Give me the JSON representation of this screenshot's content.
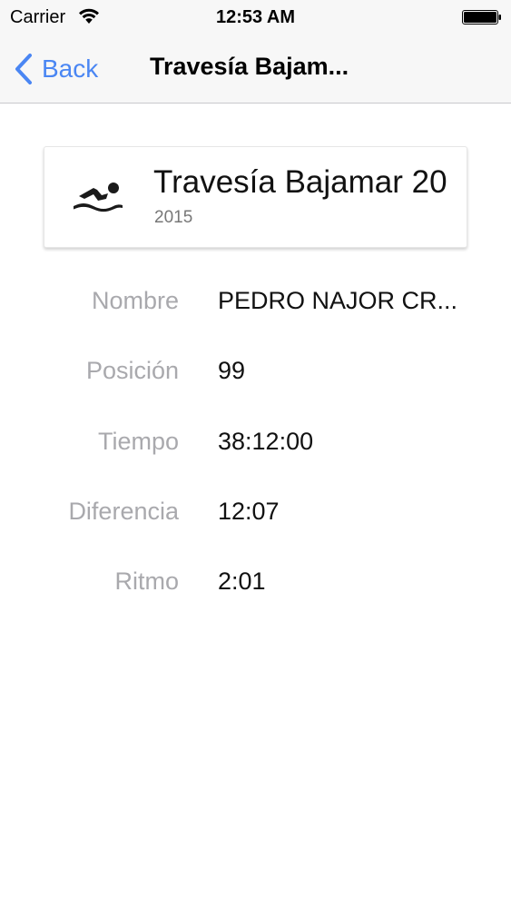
{
  "status_bar": {
    "carrier": "Carrier",
    "time": "12:53 AM",
    "wifi_icon": "wifi-icon",
    "battery_icon": "battery-icon"
  },
  "nav": {
    "back_label": "Back",
    "title": "Travesía Bajam...",
    "back_icon": "chevron-left-icon",
    "accent_color": "#4a86f3"
  },
  "event": {
    "icon": "swimmer-icon",
    "name": "Travesía Bajamar 20",
    "year": "2015"
  },
  "details": [
    {
      "label": "Nombre",
      "value": "PEDRO NAJOR CR..."
    },
    {
      "label": "Posición",
      "value": "99"
    },
    {
      "label": "Tiempo",
      "value": "38:12:00"
    },
    {
      "label": "Diferencia",
      "value": "12:07"
    },
    {
      "label": "Ritmo",
      "value": "2:01"
    }
  ]
}
